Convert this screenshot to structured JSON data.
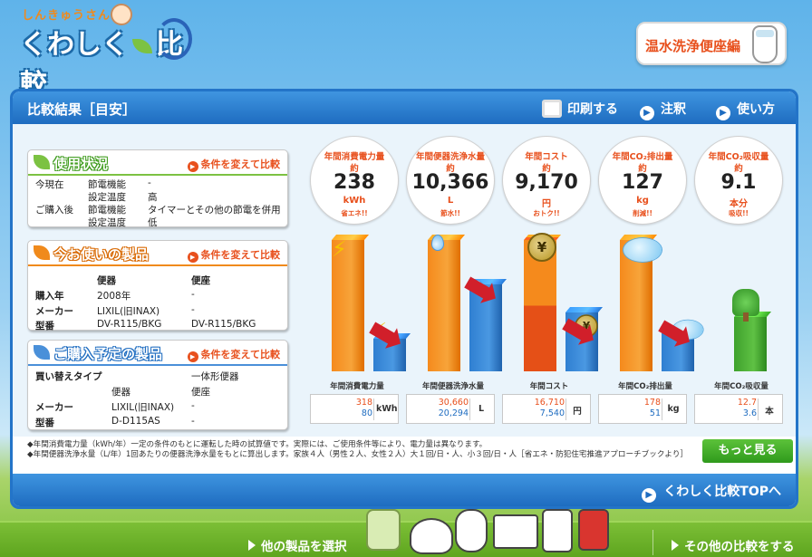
{
  "header": {
    "logo_kana": "しんきゅうさん",
    "logo_main_1": "くわしく",
    "logo_main_2": "比較",
    "category": "温水洗浄便座編"
  },
  "panel": {
    "title": "比較結果［目安］",
    "buttons": {
      "print": "印刷する",
      "notes": "注釈",
      "howto": "使い方"
    },
    "top_link": "くわしく比較TOPへ"
  },
  "usage": {
    "title": "使用状況",
    "change": "条件を変えて比較",
    "rows": [
      [
        "今現在",
        "節電機能",
        "-"
      ],
      [
        "",
        "設定温度",
        "高"
      ],
      [
        "ご購入後",
        "節電機能",
        "タイマーとその他の節電を併用"
      ],
      [
        "",
        "設定温度",
        "低"
      ]
    ]
  },
  "current": {
    "title": "今お使いの製品",
    "change": "条件を変えて比較",
    "col1": "便器",
    "col2": "便座",
    "rows": [
      [
        "購入年",
        "2008年",
        "-"
      ],
      [
        "メーカー",
        "LIXIL(旧INAX)",
        "-"
      ],
      [
        "型番",
        "DV-R115/BKG",
        "DV-R115/BKG"
      ]
    ]
  },
  "planned": {
    "title": "ご購入予定の製品",
    "change": "条件を変えて比較",
    "type_label": "買い替えタイプ",
    "type_value": "一体形便器",
    "col1": "便器",
    "col2": "便座",
    "rows": [
      [
        "メーカー",
        "LIXIL(旧INAX)",
        "-"
      ],
      [
        "型番",
        "D-D115AS",
        "-"
      ]
    ]
  },
  "stats": [
    {
      "l1": "年間消費電力量",
      "l2": "約",
      "value": "238",
      "unit": "kWh",
      "note": "省エネ!!"
    },
    {
      "l1": "年間便器洗浄水量",
      "l2": "約",
      "value": "10,366",
      "unit": "L",
      "note": "節水!!"
    },
    {
      "l1": "年間コスト",
      "l2": "約",
      "value": "9,170",
      "unit": "円",
      "note": "おトク!!"
    },
    {
      "l1": "年間CO₂排出量",
      "l2": "約",
      "value": "127",
      "unit": "kg",
      "note": "削減!!"
    },
    {
      "l1": "年間CO₂吸収量",
      "l2": "約",
      "value": "9.1",
      "unit": "本分",
      "note": "吸収!!"
    }
  ],
  "chart_data": {
    "type": "bar",
    "categories": [
      "年間消費電力量",
      "年間便器洗浄水量",
      "年間コスト",
      "年間CO₂排出量",
      "年間CO₂吸収量"
    ],
    "series": [
      {
        "values": [
          318,
          30660,
          16710,
          178,
          12.7
        ]
      },
      {
        "values": [
          80,
          20294,
          7540,
          51,
          3.6
        ]
      }
    ],
    "units": [
      "kWh",
      "L",
      "円",
      "kg",
      "本"
    ],
    "value_labels": [
      [
        "318",
        "80"
      ],
      [
        "30,660",
        "20,294"
      ],
      [
        "16,710",
        "7,540"
      ],
      [
        "178",
        "51"
      ],
      [
        "12.7",
        "3.6"
      ]
    ],
    "colors": {
      "current": "#f58a1c",
      "after": "#2f7fd1",
      "absorb": "#3ea12c",
      "after_text": "#1e6cc0",
      "current_text": "#e8501d"
    }
  },
  "notes": [
    "◆年間消費電力量（kWh/年）一定の条件のもとに運転した時の試算値です。実際には、ご使用条件等により、電力量は異なります。",
    "◆年間便器洗浄水量（L/年）1回あたりの便器洗浄水量をもとに算出します。家族４人（男性２人、女性２人）大１回/日・人、小３回/日・人［省エネ・防犯住宅推進アプローチブックより］"
  ],
  "more_button": "もっと見る",
  "footer": {
    "left": "他の製品を選択",
    "right": "その他の比較をする"
  }
}
